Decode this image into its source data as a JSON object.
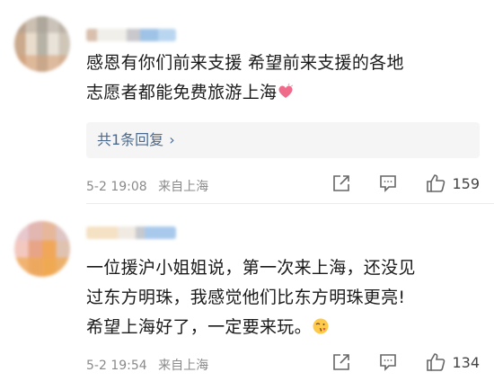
{
  "comments": [
    {
      "text_lines": [
        "感恩有你们前来支援 希望前来支援的各地",
        "志愿者都能免费旅游上海"
      ],
      "emoji": "heart-emoji",
      "reply": "共1条回复",
      "reply_arrow": "›",
      "date": "5-2 19:08",
      "location": "来自上海",
      "likes": "159"
    },
    {
      "text_lines": [
        "一位援沪小姐姐说，第一次来上海，还没见",
        "过东方明珠，我感觉他们比东方明珠更亮!",
        "希望上海好了，一定要来玩。"
      ],
      "emoji": "kissing-emoji",
      "date": "5-2 19:54",
      "location": "来自上海",
      "likes": "134"
    }
  ]
}
